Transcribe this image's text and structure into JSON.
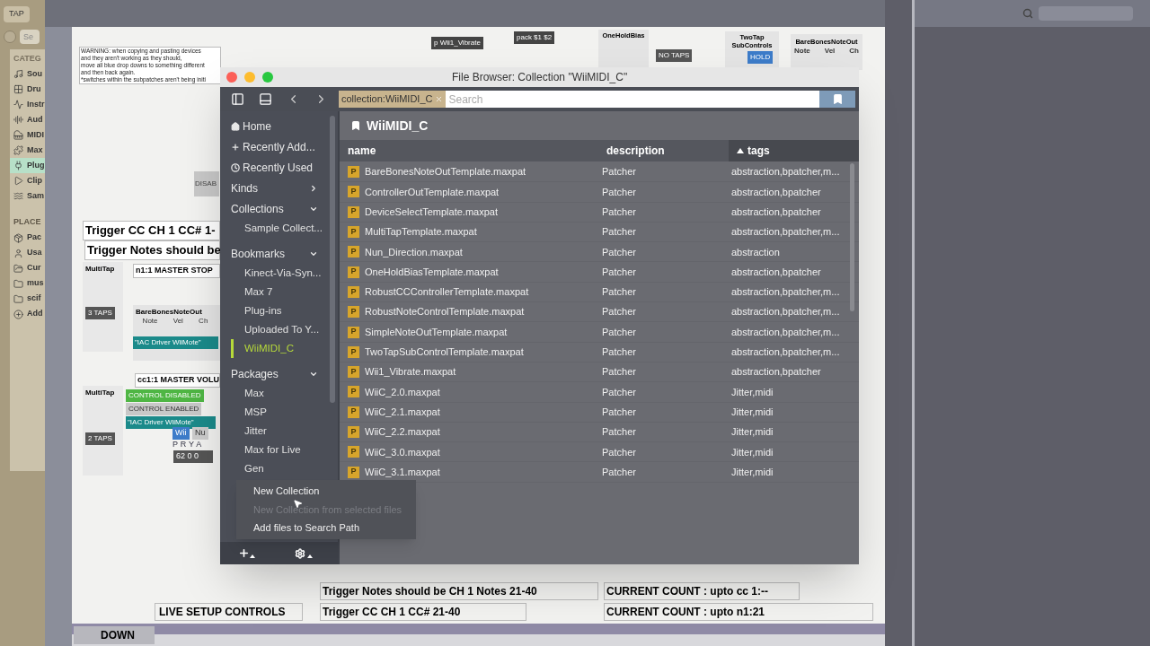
{
  "live_browser": {
    "tab": "TAP",
    "search_placeholder": "Se",
    "categories_heading": "CATEG",
    "categories": [
      {
        "label": "Sou",
        "kind": "sounds",
        "selected": false
      },
      {
        "label": "Dru",
        "kind": "drums",
        "selected": false
      },
      {
        "label": "Instr",
        "kind": "instruments",
        "selected": false
      },
      {
        "label": "Aud",
        "kind": "audio",
        "selected": false
      },
      {
        "label": "MIDI",
        "kind": "midi",
        "selected": false
      },
      {
        "label": "Max",
        "kind": "max",
        "selected": false
      },
      {
        "label": "Plug",
        "kind": "plugins",
        "selected": true
      },
      {
        "label": "Clip",
        "kind": "clips",
        "selected": false
      },
      {
        "label": "Sam",
        "kind": "samples",
        "selected": false
      }
    ],
    "places_heading": "PLACE",
    "places": [
      {
        "label": "Pac",
        "kind": "packs"
      },
      {
        "label": "Usa",
        "kind": "user"
      },
      {
        "label": "Cur",
        "kind": "current"
      },
      {
        "label": "mus",
        "kind": "folder"
      },
      {
        "label": "scif",
        "kind": "folder"
      },
      {
        "label": "Add",
        "kind": "add"
      }
    ]
  },
  "patcher": {
    "warning": "WARNING: when copying and pasting devices\nand they aren't working as they should,\nmove all blue drop downs to something different\nand then back again.\n*switches within the subpatches aren't being initi",
    "top_objects": [
      "p Wii1_Vibrate",
      "pack $1 $2"
    ],
    "one_hold_bias": "OneHoldBias",
    "two_tap": "TwoTap\nSubControls",
    "hold_menu": "HOLD",
    "no_taps": "NO TAPS",
    "bare_bones_top": "BareBonesNoteOut",
    "bare_bones_top_labels": [
      "Note",
      "Vel",
      "Ch"
    ],
    "disable": "DISAB",
    "trigger_cc": "Trigger CC CH 1  CC# 1-",
    "trigger_notes": "Trigger Notes should be",
    "multitap_1": "MultiTap",
    "master_stop": "n1:1 MASTER STOP",
    "taps_1": "3 TAPS",
    "bare_bones": "BareBonesNoteOut",
    "bare_bones_labels": [
      "Note",
      "Vel",
      "Ch"
    ],
    "driver_1": "\"IAC Driver WiiMote\"",
    "master_volume": "cc1:1 MASTER VOLU",
    "multitap_2": "MultiTap",
    "taps_2": "2 TAPS",
    "control_disabled": "CONTROL DISABLED",
    "control_enabled": "CONTROL ENABLED",
    "driver_2": "\"IAC Driver WiiMote\"",
    "wii": "Wii",
    "nu": "Nu",
    "prya": "P R Y A",
    "readout": "62 0 0",
    "bottom_comments": [
      {
        "text": "Trigger Notes should be CH 1   Notes 21-40"
      },
      {
        "text": "CURRENT COUNT : upto cc 1:--"
      },
      {
        "text": "LIVE SETUP CONTROLS"
      },
      {
        "text": "Trigger CC CH 1  CC# 21-40"
      },
      {
        "text": "CURRENT COUNT : upto n1:21"
      }
    ],
    "down_button": "DOWN"
  },
  "file_browser": {
    "title": "File Browser: Collection \"WiiMIDI_C\"",
    "search_token": "collection:WiiMIDI_C",
    "search_placeholder": "Search",
    "heading": "WiiMIDI_C",
    "sidebar": [
      {
        "label": "Home",
        "kind": "home"
      },
      {
        "label": "Recently Add...",
        "kind": "added"
      },
      {
        "label": "Recently Used",
        "kind": "used"
      },
      {
        "label": "Kinds",
        "kind": "section",
        "expanded": false
      },
      {
        "label": "Collections",
        "kind": "section",
        "expanded": true,
        "children": [
          {
            "label": "Sample Collect...",
            "selected": false
          }
        ]
      },
      {
        "label": "Bookmarks",
        "kind": "section",
        "expanded": true,
        "children": [
          {
            "label": "Kinect-Via-Syn...",
            "selected": false
          },
          {
            "label": "Max 7",
            "selected": false
          },
          {
            "label": "Plug-ins",
            "selected": false
          },
          {
            "label": "Uploaded To Y...",
            "selected": false
          },
          {
            "label": "WiiMIDI_C",
            "selected": true
          }
        ]
      },
      {
        "label": "Packages",
        "kind": "section",
        "expanded": true,
        "children": [
          {
            "label": "Max",
            "selected": false
          },
          {
            "label": "MSP",
            "selected": false
          },
          {
            "label": "Jitter",
            "selected": false
          },
          {
            "label": "Max for Live",
            "selected": false
          },
          {
            "label": "Gen",
            "selected": false
          }
        ]
      }
    ],
    "columns": [
      {
        "label": "name",
        "sorted": false
      },
      {
        "label": "description",
        "sorted": false
      },
      {
        "label": "tags",
        "sorted": true
      }
    ],
    "rows": [
      {
        "badge": "P",
        "name": "BareBonesNoteOutTemplate.maxpat",
        "description": "Patcher",
        "tags": "abstraction,bpatcher,m..."
      },
      {
        "badge": "P",
        "name": "ControllerOutTemplate.maxpat",
        "description": "Patcher",
        "tags": "abstraction,bpatcher"
      },
      {
        "badge": "P",
        "name": "DeviceSelectTemplate.maxpat",
        "description": "Patcher",
        "tags": "abstraction,bpatcher"
      },
      {
        "badge": "P",
        "name": "MultiTapTemplate.maxpat",
        "description": "Patcher",
        "tags": "abstraction,bpatcher,m..."
      },
      {
        "badge": "P",
        "name": "Nun_Direction.maxpat",
        "description": "Patcher",
        "tags": "abstraction"
      },
      {
        "badge": "P",
        "name": "OneHoldBiasTemplate.maxpat",
        "description": "Patcher",
        "tags": "abstraction,bpatcher"
      },
      {
        "badge": "P",
        "name": "RobustCCControllerTemplate.maxpat",
        "description": "Patcher",
        "tags": "abstraction,bpatcher,m..."
      },
      {
        "badge": "P",
        "name": "RobustNoteControlTemplate.maxpat",
        "description": "Patcher",
        "tags": "abstraction,bpatcher,m..."
      },
      {
        "badge": "P",
        "name": "SimpleNoteOutTemplate.maxpat",
        "description": "Patcher",
        "tags": "abstraction,bpatcher,m..."
      },
      {
        "badge": "P",
        "name": "TwoTapSubControlTemplate.maxpat",
        "description": "Patcher",
        "tags": "abstraction,bpatcher,m..."
      },
      {
        "badge": "P",
        "name": "Wii1_Vibrate.maxpat",
        "description": "Patcher",
        "tags": "abstraction,bpatcher"
      },
      {
        "badge": "P",
        "name": "WiiC_2.0.maxpat",
        "description": "Patcher",
        "tags": "Jitter,midi"
      },
      {
        "badge": "P",
        "name": "WiiC_2.1.maxpat",
        "description": "Patcher",
        "tags": "Jitter,midi"
      },
      {
        "badge": "P",
        "name": "WiiC_2.2.maxpat",
        "description": "Patcher",
        "tags": "Jitter,midi"
      },
      {
        "badge": "P",
        "name": "WiiC_3.0.maxpat",
        "description": "Patcher",
        "tags": "Jitter,midi"
      },
      {
        "badge": "P",
        "name": "WiiC_3.1.maxpat",
        "description": "Patcher",
        "tags": "Jitter,midi"
      }
    ],
    "menu": [
      {
        "label": "New Collection",
        "disabled": false
      },
      {
        "label": "New Collection from selected files",
        "disabled": true
      },
      {
        "label": "Add files to Search Path",
        "disabled": false
      }
    ]
  }
}
